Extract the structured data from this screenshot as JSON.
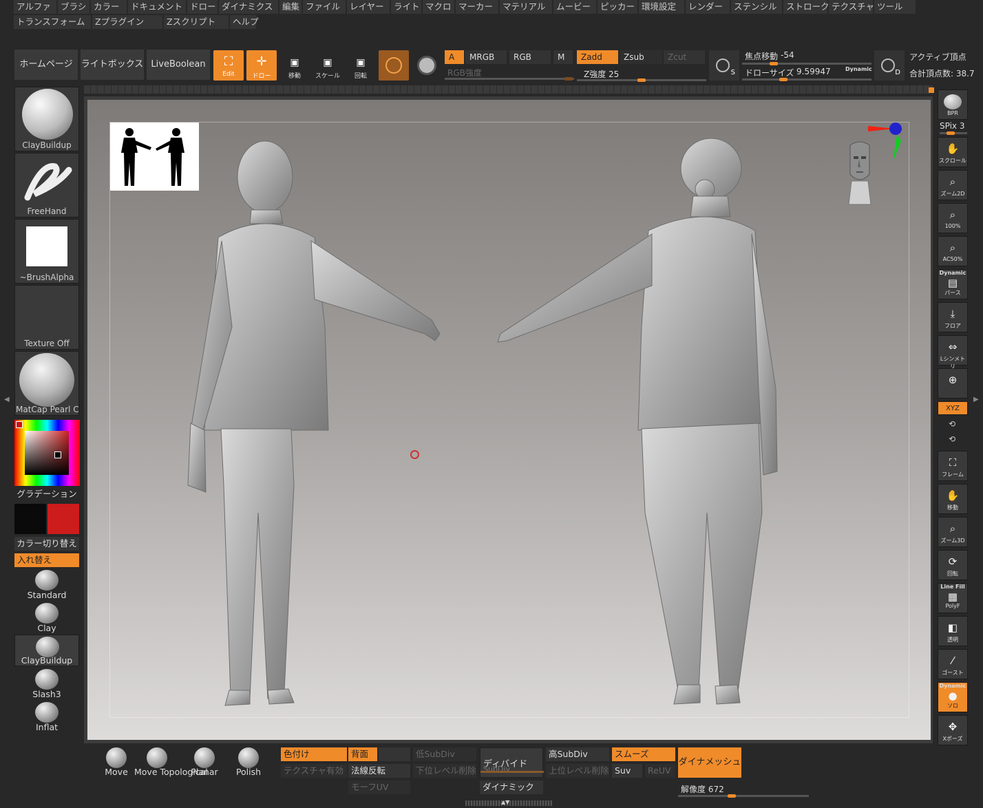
{
  "colors": {
    "accent": "#f08b2a",
    "panel": "#3a3a3a",
    "background": "#282828"
  },
  "menu": [
    "アルファ",
    "ブラシ",
    "カラー",
    "ドキュメント",
    "ドロー",
    "ダイナミクス",
    "編集",
    "ファイル",
    "レイヤー",
    "ライト",
    "マクロ",
    "マーカー",
    "マテリアル",
    "ムービー",
    "ピッカー",
    "環境設定",
    "レンダー",
    "ステンシル",
    "ストローク",
    "テクスチャ",
    "ツール",
    "トランスフォーム",
    "Zプラグイン",
    "Zスクリプト",
    "ヘルプ"
  ],
  "toolbar": {
    "home": "ホームページ",
    "lightbox": "ライトボックス",
    "liveboolean": "LiveBoolean",
    "edit": "Edit",
    "draw": "ドロー",
    "move": "移動",
    "scale": "スケール",
    "rotate": "回転",
    "a": "A",
    "mrgb": "MRGB",
    "rgb": "RGB",
    "m": "M",
    "rgb_intensity": "RGB強度",
    "zadd": "Zadd",
    "zsub": "Zsub",
    "zcut": "Zcut",
    "z_intensity": "Z強度 25",
    "focal_label": "焦点移動",
    "focal_value": "-54",
    "draw_size_label": "ドローサイズ",
    "draw_size_value": "9.59947",
    "dynamic": "Dynamic",
    "active_points": "アクティブ頂点",
    "total_points": "合計頂点数: 38.7"
  },
  "left_panel": {
    "brush": "ClayBuildup",
    "stroke": "FreeHand",
    "alpha": "~BrushAlpha",
    "texture": "Texture Off",
    "material": "MatCap Pearl Ca",
    "gradient": "グラデーション",
    "switch_color": "カラー切り替え",
    "alternate": "入れ替え",
    "primary_color": "#0a0a0a",
    "secondary_color": "#cc1c1c",
    "brushes": [
      "Standard",
      "Clay",
      "ClayBuildup",
      "Slash3",
      "Inflat"
    ]
  },
  "right_panel": {
    "bpr": "BPR",
    "spix": "SPix 3",
    "scroll": "スクロール",
    "zoom2d": "ズーム2D",
    "actual": "100%",
    "aahalf": "AC50%",
    "persp_top": "Dynamic",
    "persp": "パース",
    "floor": "フロア",
    "symmetry": "Lシンメトリ",
    "xyz": "XYZ",
    "frame": "フレーム",
    "move": "移動",
    "zoom3d": "ズーム3D",
    "rotate": "回転",
    "polyf_top": "Line Fill",
    "polyf": "PolyF",
    "transp": "透明",
    "ghost": "ゴースト",
    "solo_top": "Dynamic",
    "solo": "ソロ",
    "xpose": "Xポーズ"
  },
  "bottom": {
    "shelf_brushes": [
      "Move",
      "Move Topological",
      "Planar",
      "Polish"
    ],
    "colorize": "色付け",
    "backface": "背面",
    "texture_on": "テクスチャ有効",
    "flip": "法線反転",
    "morph_uv": "モーフUV",
    "lower_subdiv": "低SubDiv",
    "del_lower": "下位レベル削除",
    "divide": "ディバイド",
    "subdiv": "SubDiv",
    "dynamic": "ダイナミック",
    "higher_subdiv": "高SubDiv",
    "del_higher": "上位レベル削除",
    "smooth": "スムーズ",
    "suv": "Suv",
    "reuv": "ReUV",
    "dynamesh": "ダイナメッシュ",
    "resolution": "解像度 672"
  }
}
